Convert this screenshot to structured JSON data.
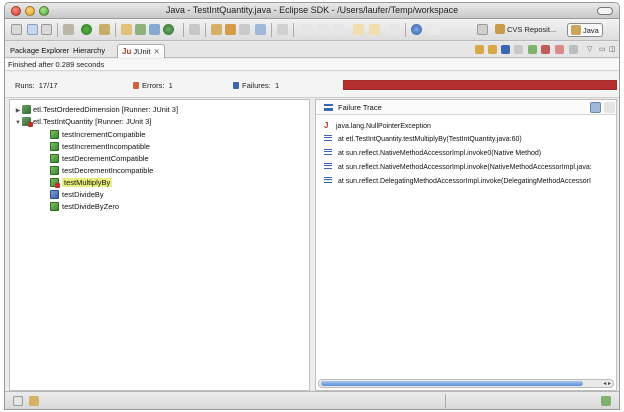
{
  "window": {
    "title": "Java - TestIntQuantity.java - Eclipse SDK - /Users/laufer/Temp/workspace"
  },
  "perspectives": {
    "cvs_label": "CVS Reposit...",
    "java_label": "Java"
  },
  "tabs": [
    {
      "label": "Package Explorer"
    },
    {
      "label": "Hierarchy"
    },
    {
      "label": "JUnit"
    }
  ],
  "junit": {
    "finished_text": "Finished after 0.289 seconds",
    "runs_label": "Runs:",
    "runs_value": "17/17",
    "errors_label": "Errors:",
    "errors_value": "1",
    "failures_label": "Failures:",
    "failures_value": "1",
    "progress_fraction": 1.0,
    "progress_color": "#b52f2f"
  },
  "tree": {
    "suites": [
      {
        "label": "etl.TestOrderedDimension [Runner: JUnit 3]"
      },
      {
        "label": "etl.TestIntQuantity [Runner: JUnit 3]"
      }
    ],
    "tests": [
      {
        "label": "testIncrementCompatible"
      },
      {
        "label": "testIncrementIncompatible"
      },
      {
        "label": "testDecrementCompatible"
      },
      {
        "label": "testDecrementIncompatible"
      },
      {
        "label": "testMultiplyBy"
      },
      {
        "label": "testDivideBy"
      },
      {
        "label": "testDivideByZero"
      }
    ]
  },
  "failure_trace": {
    "title": "Failure Trace",
    "exception": "java.lang.NullPointerException",
    "frames": [
      "at etl.TestIntQuantity.testMultiplyBy(TestIntQuantity.java:60)",
      "at sun.reflect.NativeMethodAccessorImpl.invoke0(Native Method)",
      "at sun.reflect.NativeMethodAccessorImpl.invoke(NativeMethodAccessorImpl.java:",
      "at sun.reflect.DelegatingMethodAccessorImpl.invoke(DelegatingMethodAccessorI"
    ]
  }
}
